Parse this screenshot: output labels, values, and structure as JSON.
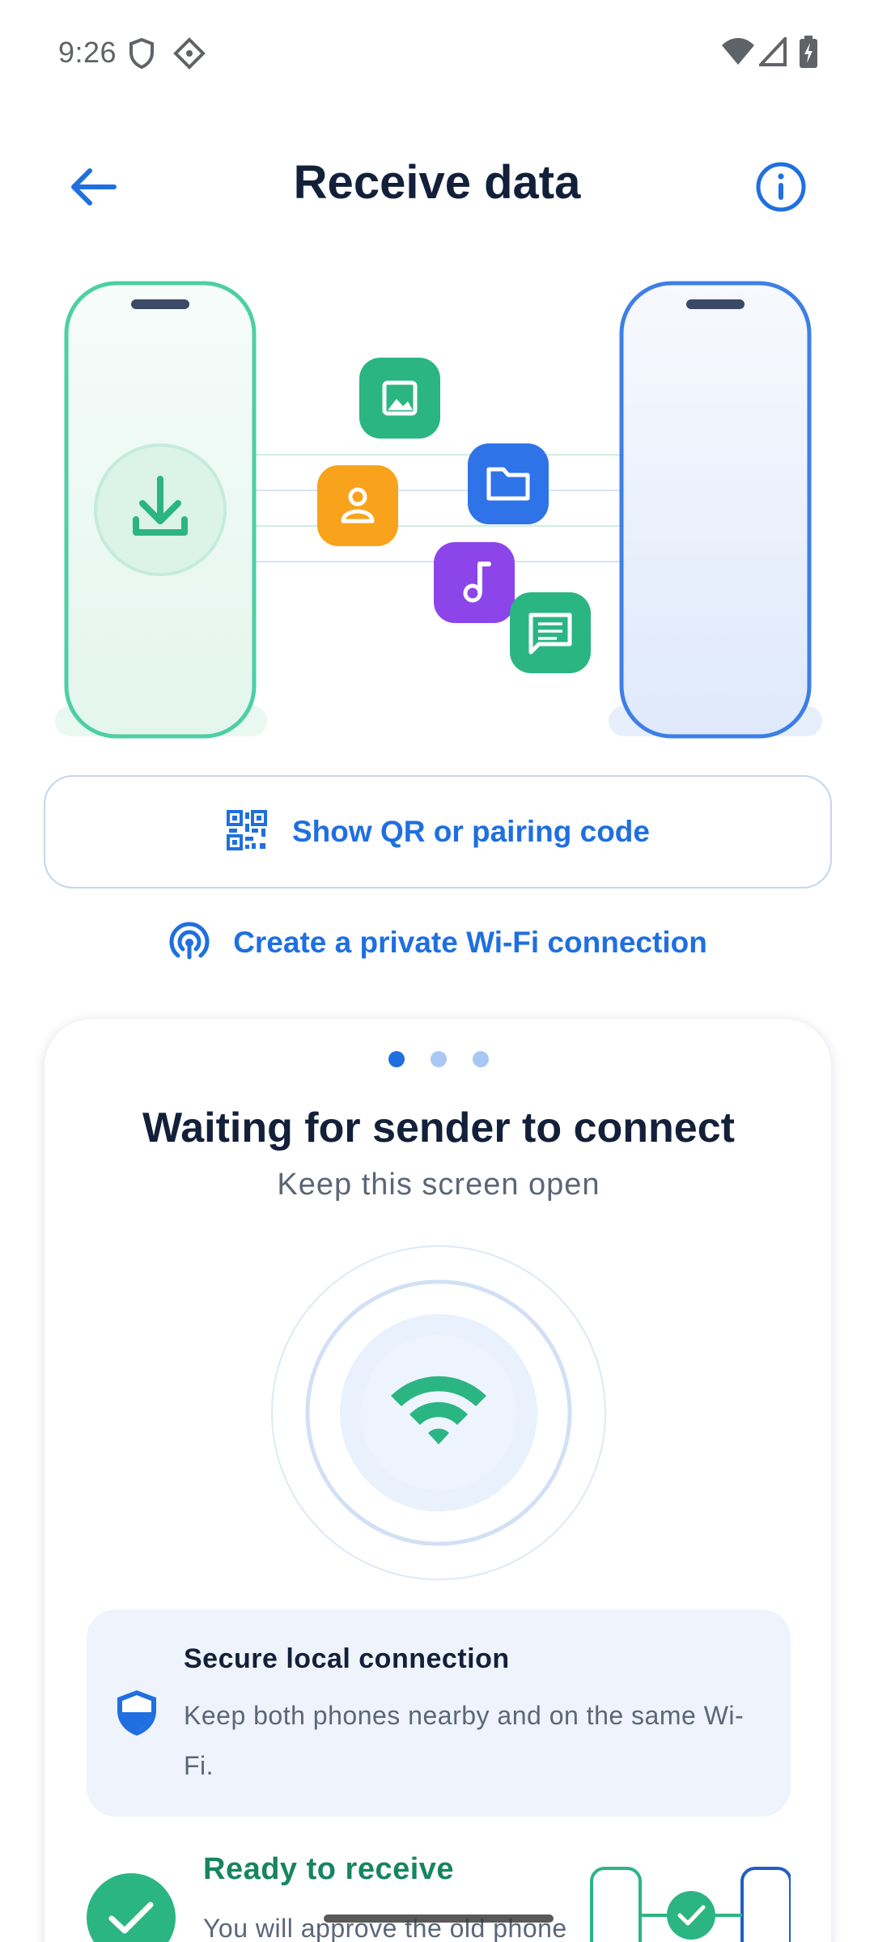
{
  "status_bar": {
    "time": "9:26",
    "icons": [
      "shield-icon",
      "sparkle-icon",
      "wifi-icon",
      "signal-icon",
      "battery-charging-icon"
    ]
  },
  "app_bar": {
    "back_icon": "arrow-left-icon",
    "title": "Receive data",
    "info_icon": "info-icon"
  },
  "illustration": {
    "left_phone_icon": "download-icon",
    "file_icons": [
      "image-icon",
      "contact-icon",
      "folder-icon",
      "music-icon",
      "message-icon"
    ],
    "colors": {
      "green": "#2bb583",
      "orange": "#f9a21b",
      "blue": "#2f73e8",
      "purple": "#8c45e8"
    }
  },
  "qr_button": {
    "icon": "qr-code-icon",
    "label": "Show QR or pairing code"
  },
  "wifi_link": {
    "icon": "wifi-hotspot-icon",
    "label": "Create a private Wi-Fi connection"
  },
  "card": {
    "page_indicator": {
      "count": 3,
      "active": 0
    },
    "title": "Waiting for sender to connect",
    "subtitle": "Keep this screen open",
    "center_icon": "wifi-icon",
    "secure": {
      "icon": "shield-icon",
      "title": "Secure local connection",
      "description": "Keep both phones nearby and on the same Wi-Fi."
    },
    "ready": {
      "icon": "check-icon",
      "title": "Ready to receive",
      "description": "You will approve the old phone"
    }
  },
  "theme": {
    "accent": "#1f6fe0",
    "title_color": "#13203a",
    "success": "#2bb583"
  }
}
